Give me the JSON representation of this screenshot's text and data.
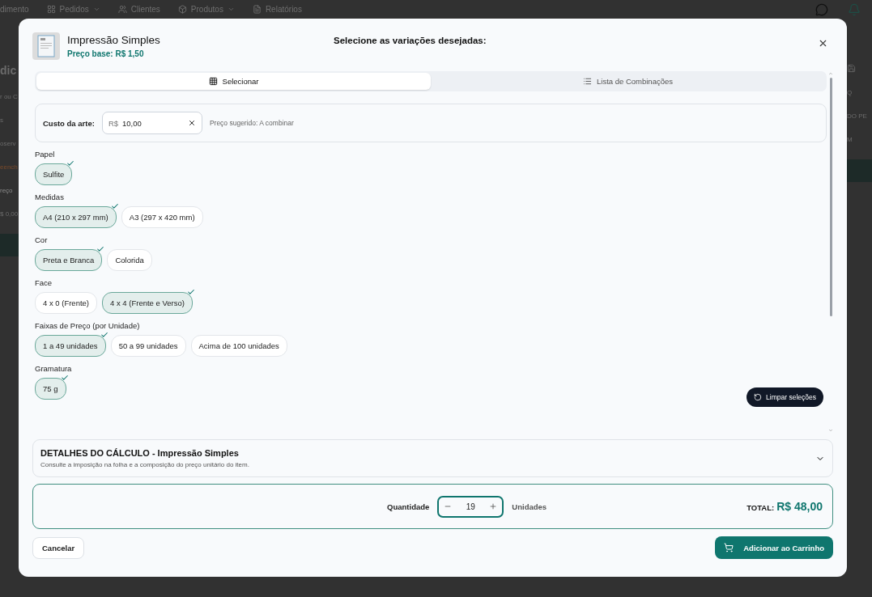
{
  "background": {
    "nav": [
      {
        "label": "dimento",
        "has_menu": false
      },
      {
        "label": "Pedidos",
        "has_menu": true
      },
      {
        "label": "Clientes",
        "has_menu": false
      },
      {
        "label": "Produtos",
        "has_menu": true
      },
      {
        "label": "Relatórios",
        "has_menu": false
      }
    ],
    "left_fragments": [
      {
        "text": "dic",
        "kind": "heading"
      },
      {
        "text": "r ou C",
        "kind": "text"
      },
      {
        "text": "s",
        "kind": "text"
      },
      {
        "text": "oserv",
        "kind": "text"
      },
      {
        "text": "eench",
        "kind": "warning"
      },
      {
        "text": "reço",
        "kind": "label"
      },
      {
        "text": "$ 0,00",
        "kind": "text"
      }
    ],
    "right_fragments": [
      "Q",
      "DO PE",
      "M"
    ]
  },
  "dialog": {
    "title": "Impressão Simples",
    "base_price": "Preço base: R$ 1,50",
    "prompt": "Selecione as variações desejadas:",
    "tabs": [
      {
        "label": "Selecionar",
        "selected": true
      },
      {
        "label": "Lista de Combinações",
        "selected": false
      }
    ],
    "art_cost": {
      "label": "Custo da arte:",
      "prefix": "R$",
      "value": "10,00",
      "hint": "Preço sugerido: A combinar"
    },
    "groups": [
      {
        "label": "Papel",
        "options": [
          {
            "label": "Sulfite",
            "selected": true
          }
        ]
      },
      {
        "label": "Medidas",
        "options": [
          {
            "label": "A4 (210 x 297 mm)",
            "selected": true
          },
          {
            "label": "A3 (297 x 420 mm)",
            "selected": false
          }
        ]
      },
      {
        "label": "Cor",
        "options": [
          {
            "label": "Preta e Branca",
            "selected": true
          },
          {
            "label": "Colorida",
            "selected": false
          }
        ]
      },
      {
        "label": "Face",
        "options": [
          {
            "label": "4 x 0 (Frente)",
            "selected": false
          },
          {
            "label": "4 x 4 (Frente e Verso)",
            "selected": true
          }
        ]
      },
      {
        "label": "Faixas de Preço (por Unidade)",
        "options": [
          {
            "label": "1 a 49 unidades",
            "selected": true
          },
          {
            "label": "50 a 99 unidades",
            "selected": false
          },
          {
            "label": "Acima de 100 unidades",
            "selected": false
          }
        ]
      },
      {
        "label": "Gramatura",
        "options": [
          {
            "label": "75 g",
            "selected": true
          }
        ]
      }
    ],
    "clear_button": "Limpar seleções",
    "details": {
      "title": "DETALHES DO CÁLCULO - Impressão Simples",
      "description": "Consulte a imposição na folha e a composição do preço unitário do item.",
      "expanded": false
    },
    "quantity": {
      "label": "Quantidade",
      "value": "19",
      "unit": "Unidades"
    },
    "total": {
      "label": "TOTAL:",
      "value": "R$ 48,00"
    },
    "buttons": {
      "cancel": "Cancelar",
      "add": "Adicionar ao Carrinho"
    }
  }
}
